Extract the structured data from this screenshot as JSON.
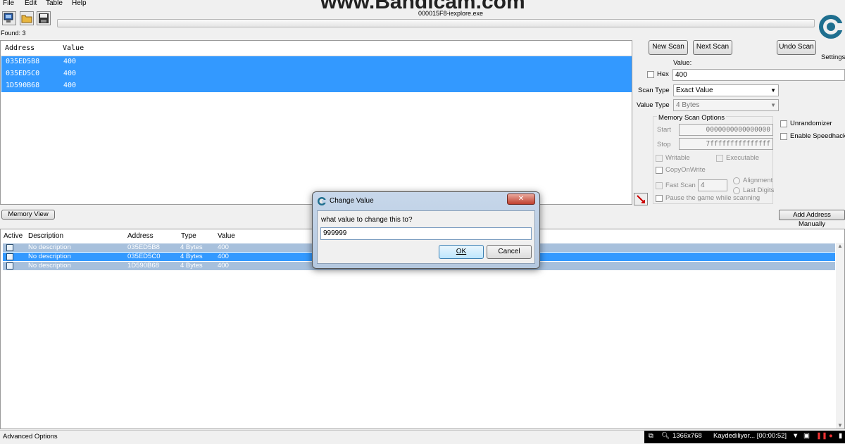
{
  "menu": [
    "File",
    "Edit",
    "Table",
    "Help"
  ],
  "watermark": "www.Bandicam.com",
  "process_title": "000015F8-iexplore.exe",
  "found_label": "Found: 3",
  "results": {
    "headers": [
      "Address",
      "Value"
    ],
    "rows": [
      {
        "address": "035ED5B8",
        "value": "400"
      },
      {
        "address": "035ED5C0",
        "value": "400"
      },
      {
        "address": "1D590B68",
        "value": "400"
      }
    ]
  },
  "scan": {
    "new_scan": "New Scan",
    "next_scan": "Next Scan",
    "undo_scan": "Undo Scan",
    "settings": "Settings",
    "value_label": "Value:",
    "hex_label": "Hex",
    "value": "400",
    "scan_type_label": "Scan Type",
    "scan_type_value": "Exact Value",
    "value_type_label": "Value Type",
    "value_type_value": "4 Bytes",
    "memory_options_title": "Memory Scan Options",
    "start_label": "Start",
    "start_value": "0000000000000000",
    "stop_label": "Stop",
    "stop_value": "7fffffffffffffff",
    "writable": "Writable",
    "executable": "Executable",
    "copy_on_write": "CopyOnWrite",
    "fast_scan": "Fast Scan",
    "fast_scan_value": "4",
    "alignment": "Alignment",
    "last_digits": "Last Digits",
    "pause_game": "Pause the game while scanning",
    "unrandomizer": "Unrandomizer",
    "enable_speedhack": "Enable Speedhack"
  },
  "memory_view": "Memory View",
  "add_address_manually": "Add Address Manually",
  "address_list": {
    "headers": [
      "Active",
      "Description",
      "Address",
      "Type",
      "Value"
    ],
    "rows": [
      {
        "description": "No description",
        "address": "035ED5B8",
        "type": "4 Bytes",
        "value": "400",
        "selected": false
      },
      {
        "description": "No description",
        "address": "035ED5C0",
        "type": "4 Bytes",
        "value": "400",
        "selected": true
      },
      {
        "description": "No description",
        "address": "1D590B68",
        "type": "4 Bytes",
        "value": "400",
        "selected": false
      }
    ]
  },
  "advanced_options": "Advanced Options",
  "dialog": {
    "title": "Change Value",
    "prompt": "what value to change this to?",
    "input_value": "999999",
    "ok": "OK",
    "cancel": "Cancel",
    "close": "✕"
  },
  "taskbar": {
    "resolution": "1366x768",
    "recording": "Kaydediliyor... [00:00:52]"
  },
  "colors": {
    "selection": "#3399ff",
    "row_inactive": "#a7c0dc",
    "window_bg": "#f0f0f0"
  }
}
